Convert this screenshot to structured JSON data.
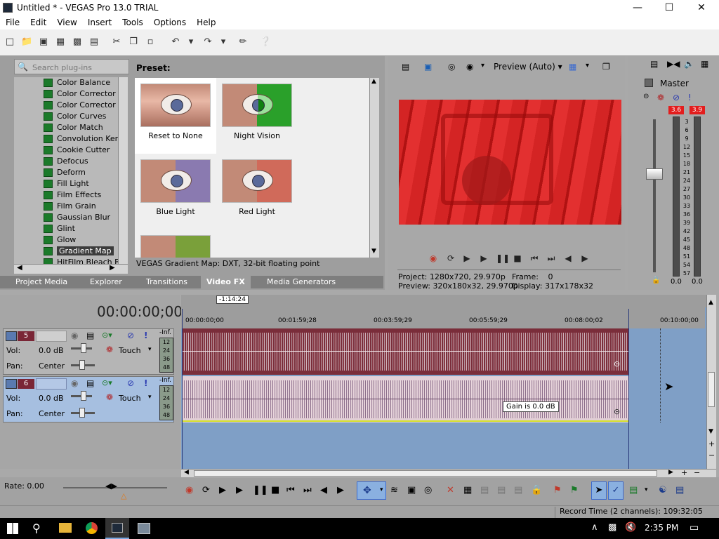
{
  "window": {
    "title": "Untitled * - VEGAS Pro 13.0 TRIAL",
    "minimize": "—",
    "maximize": "☐",
    "close": "✕"
  },
  "menu": [
    "File",
    "Edit",
    "View",
    "Insert",
    "Tools",
    "Options",
    "Help"
  ],
  "plugins": {
    "search_placeholder": "Search plug-ins",
    "items": [
      "Color Balance",
      "Color Corrector",
      "Color Corrector (S",
      "Color Curves",
      "Color Match",
      "Convolution Kerne",
      "Cookie Cutter",
      "Defocus",
      "Deform",
      "Fill Light",
      "Film Effects",
      "Film Grain",
      "Gaussian Blur",
      "Glint",
      "Glow",
      "Gradient Map",
      "HitFilm Bleach Byp"
    ],
    "selected": "Gradient Map"
  },
  "presets": {
    "heading": "Preset:",
    "items": [
      "Reset to None",
      "Night Vision",
      "Blue Light",
      "Red  Light"
    ],
    "footer": "VEGAS Gradient Map: DXT, 32-bit floating point"
  },
  "tabs": [
    "Project Media",
    "Explorer",
    "Transitions",
    "Video FX",
    "Media Generators"
  ],
  "active_tab": "Video FX",
  "preview": {
    "mode": "Preview (Auto)",
    "project_label": "Project:",
    "project_value": "1280x720, 29.970p",
    "preview_label": "Preview:",
    "preview_value": "320x180x32, 29.970p",
    "frame_label": "Frame:",
    "frame_value": "0",
    "display_label": "Display:",
    "display_value": "317x178x32"
  },
  "master": {
    "title": "Master",
    "peak_left": "3.6",
    "peak_right": "3.9",
    "scale": [
      "3",
      "6",
      "9",
      "12",
      "15",
      "18",
      "21",
      "24",
      "27",
      "30",
      "33",
      "36",
      "39",
      "42",
      "45",
      "48",
      "51",
      "54",
      "57"
    ],
    "value_left": "0.0",
    "value_right": "0.0"
  },
  "timeline": {
    "timecode": "00:00:00;00",
    "marker_length": "-1:14:24",
    "ruler": [
      "00:00:00;00",
      "00:01:59;28",
      "00:03:59;29",
      "00:05:59;29",
      "00:08:00;02",
      "00:10:00;00"
    ],
    "tooltip": "Gain is 0.0 dB"
  },
  "tracks": [
    {
      "number": "5",
      "vol_label": "Vol:",
      "vol_value": "0.0 dB",
      "pan_label": "Pan:",
      "pan_value": "Center",
      "mode": "Touch",
      "meter_top": "-Inf.",
      "meter_scale": [
        "12",
        "24",
        "36",
        "48"
      ]
    },
    {
      "number": "6",
      "vol_label": "Vol:",
      "vol_value": "0.0 dB",
      "pan_label": "Pan:",
      "pan_value": "Center",
      "mode": "Touch",
      "meter_top": "-Inf.",
      "meter_scale": [
        "12",
        "24",
        "36",
        "48"
      ]
    }
  ],
  "rate": "Rate: 0.00",
  "status": "Record Time (2 channels): 109:32:05",
  "clock": "2:35 PM",
  "colors": {
    "preview_red": "#c81a1a",
    "track5_wave": "#8a3a46",
    "track6_wave": "#e2cfd6",
    "timeline_bg": "#7f9fc6"
  }
}
